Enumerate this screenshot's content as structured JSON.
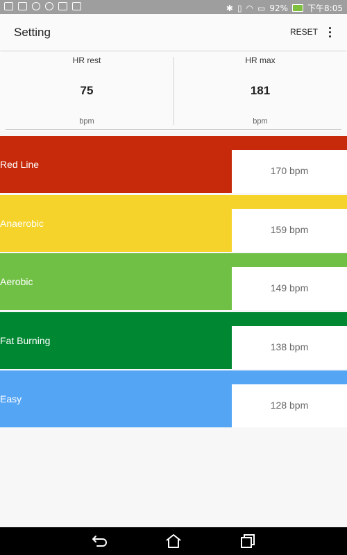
{
  "status_bar": {
    "battery": "92%",
    "time": "下午8:05"
  },
  "toolbar": {
    "title": "Setting",
    "reset_label": "RESET"
  },
  "hr": {
    "rest": {
      "label": "HR rest",
      "value": "75",
      "unit": "bpm"
    },
    "max": {
      "label": "HR max",
      "value": "181",
      "unit": "bpm"
    }
  },
  "zones": [
    {
      "name": "Red Line",
      "value": "170 bpm",
      "color": "#c62a0b"
    },
    {
      "name": "Anaerobic",
      "value": "159 bpm",
      "color": "#f5d32a"
    },
    {
      "name": "Aerobic",
      "value": "149 bpm",
      "color": "#71c046"
    },
    {
      "name": "Fat Burning",
      "value": "138 bpm",
      "color": "#008732"
    },
    {
      "name": "Easy",
      "value": "128 bpm",
      "color": "#55a5f5"
    }
  ],
  "colors": {
    "status_bar": "#9e9e9e",
    "toolbar": "#fafafa",
    "background": "#f7f7f7"
  },
  "icons": [
    "back-icon",
    "home-icon",
    "recents-icon",
    "overflow-menu-icon"
  ]
}
